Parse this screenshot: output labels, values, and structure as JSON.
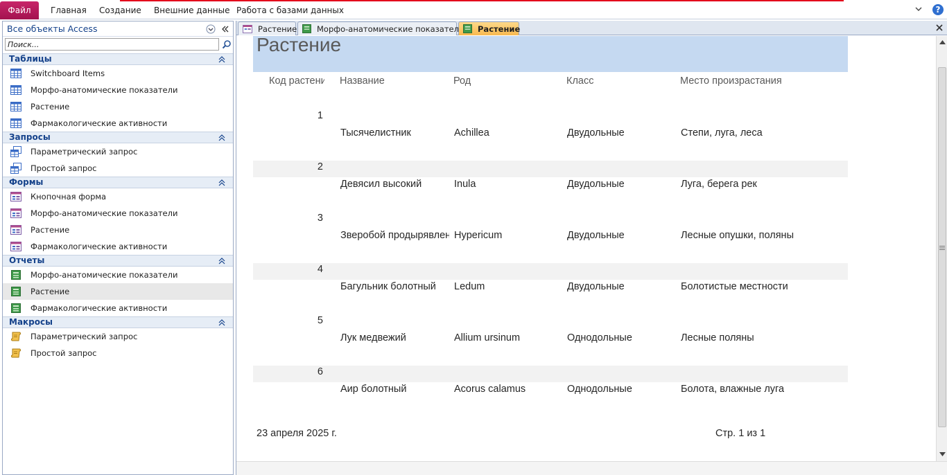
{
  "ribbon": {
    "tabs": [
      "Файл",
      "Главная",
      "Создание",
      "Внешние данные",
      "Работа с базами данных"
    ]
  },
  "nav": {
    "header": "Все объекты Access",
    "search_placeholder": "Поиск...",
    "groups": [
      {
        "title": "Таблицы",
        "items": [
          "Switchboard Items",
          "Морфо-анатомические показатели",
          "Растение",
          "Фармакологические активности"
        ]
      },
      {
        "title": "Запросы",
        "items": [
          "Параметрический запрос",
          "Простой запрос"
        ]
      },
      {
        "title": "Формы",
        "items": [
          "Кнопочная форма",
          "Морфо-анатомические показатели",
          "Растение",
          "Фармакологические активности"
        ]
      },
      {
        "title": "Отчеты",
        "items": [
          "Морфо-анатомические показатели",
          "Растение",
          "Фармакологические активности"
        ]
      },
      {
        "title": "Макросы",
        "items": [
          "Параметрический запрос",
          "Простой запрос"
        ]
      }
    ]
  },
  "doc_tabs": [
    "Растение",
    "Морфо-анатомические показатели",
    "Растение"
  ],
  "report": {
    "title": "Растение",
    "columns": [
      "Код растения",
      "Название",
      "Род",
      "Класс",
      "Место произрастания"
    ],
    "rows": [
      {
        "code": "1",
        "name": "Тысячелистник",
        "genus": "Achillea",
        "class": "Двудольные",
        "place": "Степи, луга, леса"
      },
      {
        "code": "2",
        "name": "Девясил высокий",
        "genus": "Inula",
        "class": "Двудольные",
        "place": "Луга, берега рек"
      },
      {
        "code": "3",
        "name": "Зверобой продырявленный",
        "genus": "Hypericum",
        "class": "Двудольные",
        "place": "Лесные опушки, поляны"
      },
      {
        "code": "4",
        "name": "Багульник болотный",
        "genus": "Ledum",
        "class": "Двудольные",
        "place": "Болотистые местности"
      },
      {
        "code": "5",
        "name": "Лук медвежий",
        "genus": "Allium ursinum",
        "class": "Однодольные",
        "place": "Лесные поляны"
      },
      {
        "code": "6",
        "name": "Аир болотный",
        "genus": "Acorus calamus",
        "class": "Однодольные",
        "place": "Болота, влажные луга"
      }
    ],
    "date": "23 апреля 2025 г.",
    "page": "Стр. 1 из 1"
  },
  "colors": {
    "file_tab": "#b3175d",
    "title_band": "#c5d9f1",
    "group_header": "#e6edf6",
    "active_tab": "#f8b94f",
    "accent_text": "#15428b"
  }
}
